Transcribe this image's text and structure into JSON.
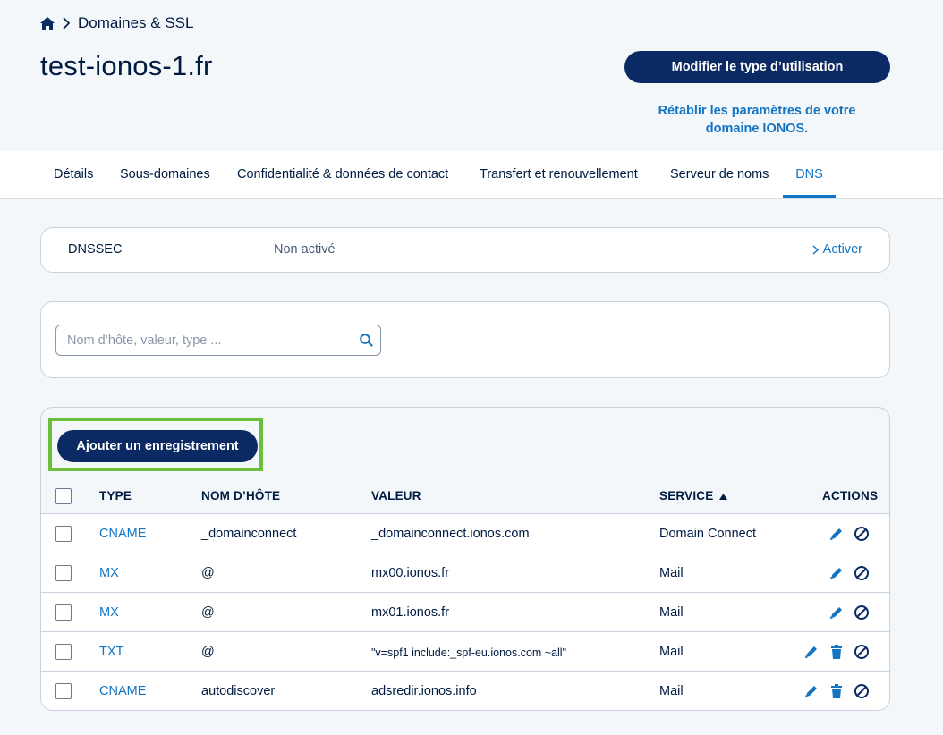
{
  "breadcrumb": {
    "home_icon": "home-icon",
    "current": "Domaines & SSL"
  },
  "page": {
    "title": "test-ionos-1.fr",
    "primary_button": "Modifier le type d’utilisation",
    "restore_link": "Rétablir les paramètres de votre domaine IONOS."
  },
  "tabs": [
    {
      "label": "Détails"
    },
    {
      "label": "Sous-domaines"
    },
    {
      "label": "Confidentialité & données de contact"
    },
    {
      "label": "Transfert et renouvellement"
    },
    {
      "label": "Serveur de noms"
    },
    {
      "label": "DNS",
      "active": true
    }
  ],
  "dnssec": {
    "label": "DNSSEC",
    "status": "Non activé",
    "action": "Activer"
  },
  "search": {
    "placeholder": "Nom d’hôte, valeur, type ..."
  },
  "records": {
    "add_button": "Ajouter un enregistrement",
    "columns": {
      "type": "TYPE",
      "host": "NOM D’HÔTE",
      "value": "VALEUR",
      "service": "SERVICE",
      "actions": "ACTIONS"
    },
    "rows": [
      {
        "type": "CNAME",
        "host": "_domainconnect",
        "value": "_domainconnect.ionos.com",
        "service": "Domain Connect",
        "actions": [
          "edit",
          "disable"
        ]
      },
      {
        "type": "MX",
        "host": "@",
        "value": "mx00.ionos.fr",
        "service": "Mail",
        "actions": [
          "edit",
          "disable"
        ]
      },
      {
        "type": "MX",
        "host": "@",
        "value": "mx01.ionos.fr",
        "service": "Mail",
        "actions": [
          "edit",
          "disable"
        ]
      },
      {
        "type": "TXT",
        "host": "@",
        "value": "\"v=spf1 include:_spf-eu.ionos.com ~all\"",
        "service": "Mail",
        "actions": [
          "edit",
          "delete",
          "disable"
        ]
      },
      {
        "type": "CNAME",
        "host": "autodiscover",
        "value": "adsredir.ionos.info",
        "service": "Mail",
        "actions": [
          "edit",
          "delete",
          "disable"
        ]
      }
    ]
  },
  "colors": {
    "navy": "#0b2a63",
    "link": "#1474c4",
    "highlight": "#6cbf3a"
  }
}
